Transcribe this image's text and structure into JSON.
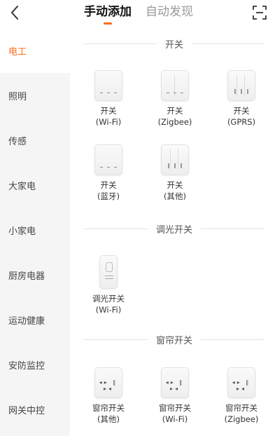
{
  "header": {
    "tabs": [
      {
        "label": "手动添加",
        "active": true
      },
      {
        "label": "自动发现",
        "active": false
      }
    ],
    "accent_color": "#ff6a1a"
  },
  "sidebar": {
    "items": [
      {
        "label": "电工",
        "active": true
      },
      {
        "label": "照明"
      },
      {
        "label": "传感"
      },
      {
        "label": "大家电"
      },
      {
        "label": "小家电"
      },
      {
        "label": "厨房电器"
      },
      {
        "label": "运动健康"
      },
      {
        "label": "安防监控"
      },
      {
        "label": "网关中控"
      }
    ]
  },
  "sections": [
    {
      "title": "开关",
      "devices": [
        {
          "name": "开关",
          "sub": "(Wi-Fi)"
        },
        {
          "name": "开关",
          "sub": "(Zigbee)"
        },
        {
          "name": "开关",
          "sub": "(GPRS)"
        },
        {
          "name": "开关",
          "sub": "(蓝牙)"
        },
        {
          "name": "开关",
          "sub": "(其他)"
        }
      ]
    },
    {
      "title": "调光开关",
      "devices": [
        {
          "name": "调光开关",
          "sub": "(Wi-Fi)"
        }
      ]
    },
    {
      "title": "窗帘开关",
      "devices": [
        {
          "name": "窗帘开关",
          "sub": "(其他)"
        },
        {
          "name": "窗帘开关",
          "sub": "(Wi-Fi)"
        },
        {
          "name": "窗帘开关",
          "sub": "(Zigbee)"
        }
      ]
    }
  ]
}
